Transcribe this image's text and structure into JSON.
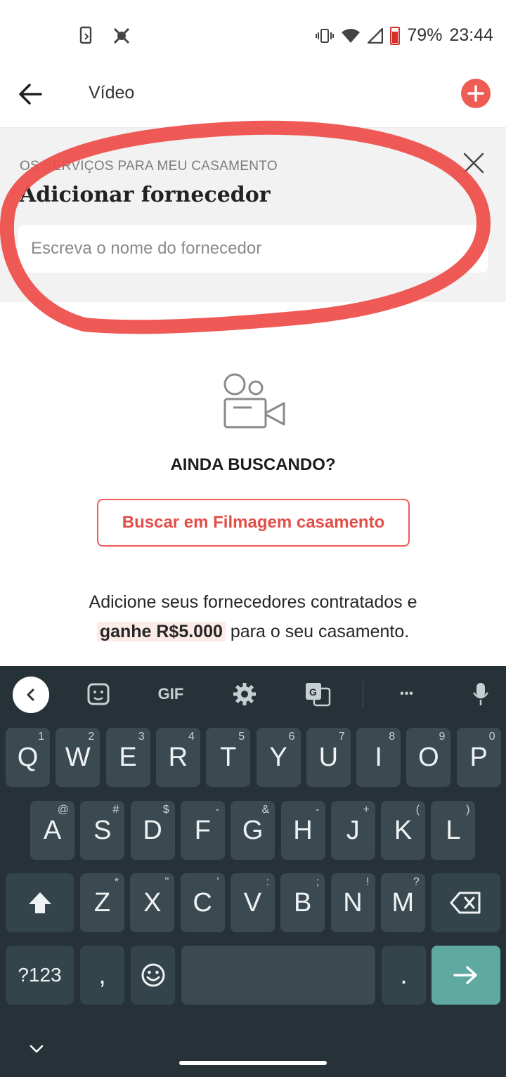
{
  "status_bar": {
    "battery": "79%",
    "time": "23:44",
    "battery_color": "#d0322b"
  },
  "app_bar": {
    "title": "Vídeo",
    "accent": "#ef5b55"
  },
  "add_vendor_panel": {
    "eyebrow": "OS SERVIÇOS PARA MEU CASAMENTO",
    "heading": "Adicionar fornecedor",
    "input_placeholder": "Escreva o nome do fornecedor",
    "input_value": ""
  },
  "empty_state": {
    "icon": "video-camera-icon",
    "title": "AINDA BUSCANDO?",
    "search_button": "Buscar em Filmagem casamento",
    "promo_before": "Adicione seus fornecedores contratados e",
    "promo_highlight": "ganhe R$5.000",
    "promo_after": "para o seu casamento."
  },
  "keyboard": {
    "toolbar": {
      "gif": "GIF",
      "more": "•••"
    },
    "row1": [
      {
        "k": "Q",
        "h": "1"
      },
      {
        "k": "W",
        "h": "2"
      },
      {
        "k": "E",
        "h": "3"
      },
      {
        "k": "R",
        "h": "4"
      },
      {
        "k": "T",
        "h": "5"
      },
      {
        "k": "Y",
        "h": "6"
      },
      {
        "k": "U",
        "h": "7"
      },
      {
        "k": "I",
        "h": "8"
      },
      {
        "k": "O",
        "h": "9"
      },
      {
        "k": "P",
        "h": "0"
      }
    ],
    "row2": [
      {
        "k": "A",
        "h": "@"
      },
      {
        "k": "S",
        "h": "#"
      },
      {
        "k": "D",
        "h": "$"
      },
      {
        "k": "F",
        "h": "-"
      },
      {
        "k": "G",
        "h": "&"
      },
      {
        "k": "H",
        "h": "-"
      },
      {
        "k": "J",
        "h": "+"
      },
      {
        "k": "K",
        "h": "("
      },
      {
        "k": "L",
        "h": ")"
      }
    ],
    "row3": [
      {
        "k": "Z",
        "h": "*"
      },
      {
        "k": "X",
        "h": "\""
      },
      {
        "k": "C",
        "h": "'"
      },
      {
        "k": "V",
        "h": ":"
      },
      {
        "k": "B",
        "h": ";"
      },
      {
        "k": "N",
        "h": "!"
      },
      {
        "k": "M",
        "h": "?"
      }
    ],
    "symbols_key": "?123",
    "comma_key": ",",
    "period_key": ".",
    "keyboard_bg": "#263238",
    "enter_color": "#5fa9a0"
  }
}
